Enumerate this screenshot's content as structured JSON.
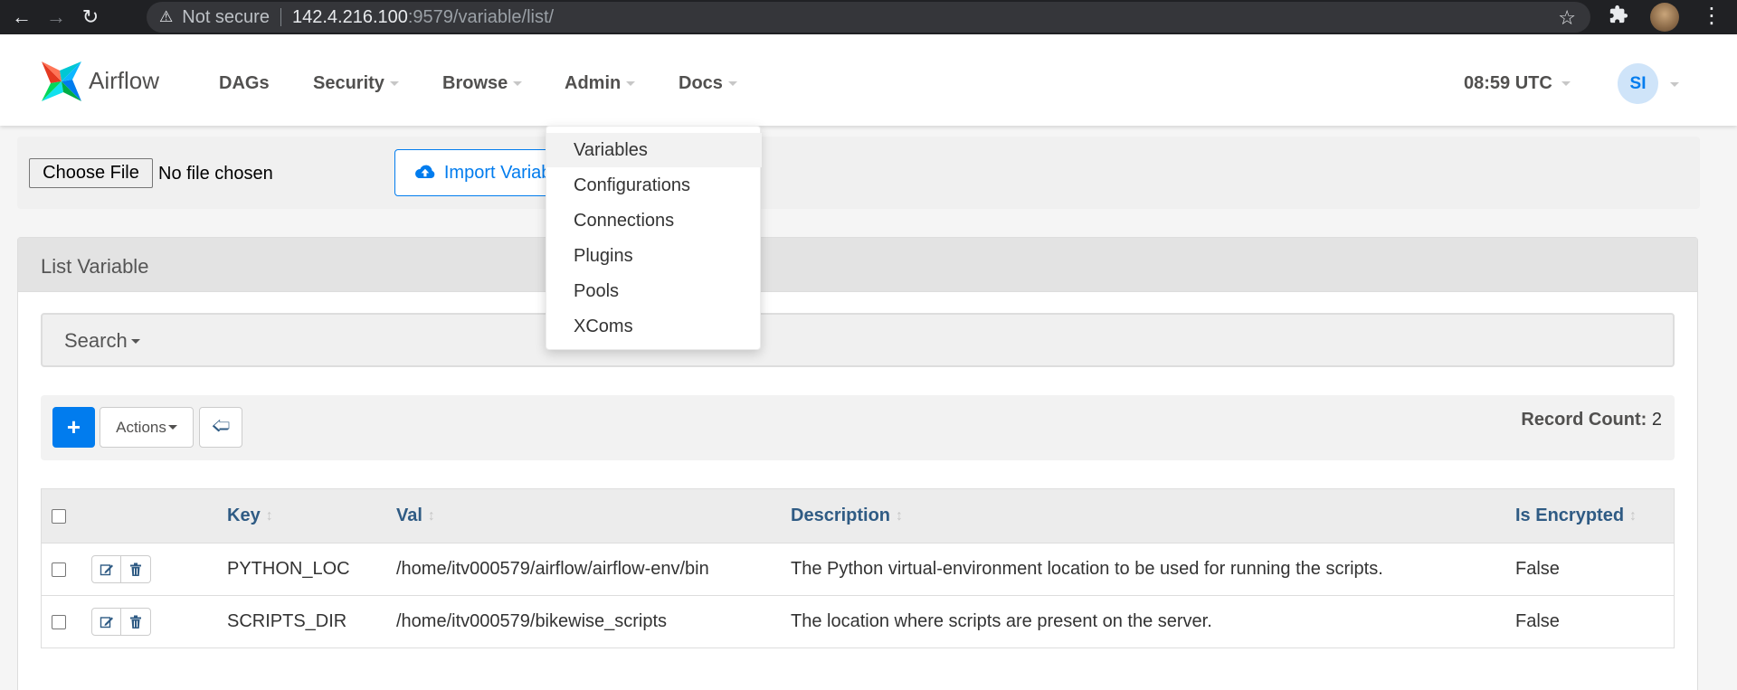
{
  "browser": {
    "security_label": "Not secure",
    "url_host": "142.4.216.100",
    "url_rest": ":9579/variable/list/"
  },
  "navbar": {
    "brand": "Airflow",
    "menu": [
      {
        "label": "DAGs"
      },
      {
        "label": "Security"
      },
      {
        "label": "Browse"
      },
      {
        "label": "Admin"
      },
      {
        "label": "Docs"
      }
    ],
    "clock": "08:59 UTC",
    "user_initials": "SI"
  },
  "admin_menu": {
    "items": [
      {
        "label": "Variables"
      },
      {
        "label": "Configurations"
      },
      {
        "label": "Connections"
      },
      {
        "label": "Plugins"
      },
      {
        "label": "Pools"
      },
      {
        "label": "XComs"
      }
    ],
    "active": "Variables"
  },
  "import": {
    "choose_file_label": "Choose File",
    "no_file_text": "No file chosen",
    "import_button_label": "Import Variables"
  },
  "panel": {
    "title": "List Variable",
    "search_label": "Search",
    "actions_label": "Actions",
    "record_count_label": "Record Count:",
    "record_count": "2"
  },
  "table": {
    "columns": [
      {
        "label": "Key"
      },
      {
        "label": "Val"
      },
      {
        "label": "Description"
      },
      {
        "label": "Is Encrypted"
      }
    ],
    "rows": [
      {
        "key": "PYTHON_LOC",
        "val": "/home/itv000579/airflow/airflow-env/bin",
        "description": "The Python virtual-environment location to be used for running the scripts.",
        "is_encrypted": "False"
      },
      {
        "key": "SCRIPTS_DIR",
        "val": "/home/itv000579/bikewise_scripts",
        "description": "The location where scripts are present on the server.",
        "is_encrypted": "False"
      }
    ]
  },
  "colors": {
    "primary": "#017cee",
    "nav_text": "#51504f",
    "header_link": "#2f5b84",
    "avatar_bg": "#cfe4f9"
  }
}
